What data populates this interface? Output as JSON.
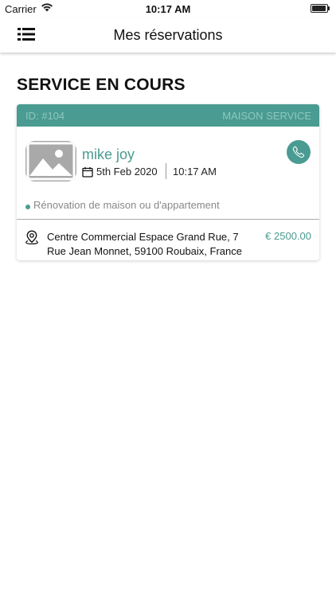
{
  "status_bar": {
    "carrier": "Carrier",
    "time": "10:17 AM"
  },
  "header": {
    "title": "Mes réservations",
    "menu_icon": "list-icon"
  },
  "section": {
    "title": "SERVICE EN COURS"
  },
  "booking": {
    "id": "ID: #104",
    "category": "MAISON SERVICE",
    "customer_name": "mike joy",
    "date": "5th Feb 2020",
    "time": "10:17 AM",
    "service": "Rénovation de maison ou d'appartement",
    "address": "Centre Commercial Espace Grand Rue, 7 Rue Jean Monnet, 59100 Roubaix, France",
    "price": "€ 2500.00"
  },
  "colors": {
    "accent": "#4a9b91",
    "header_text": "#8fc8c0",
    "muted_text": "#888888"
  }
}
